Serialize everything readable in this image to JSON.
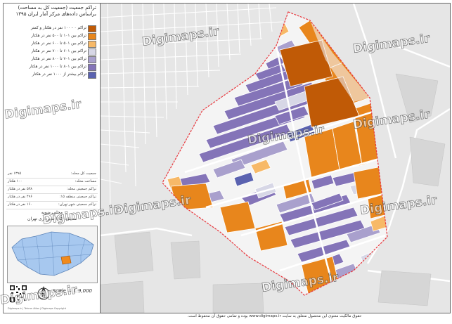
{
  "title": {
    "line1": "تراکم جمعیت (جمعیت کل به مساحت)",
    "line2": "براساس داده‌های مرکز آمار ایران ۱۳۹۵"
  },
  "legend": [
    {
      "label": "تراکم ۰ - ۱۰۰ نفر در هکتار و کمتر",
      "color": "#c05a06"
    },
    {
      "label": "تراکم بین ۱۰۱ تا ۵۰۰ نفر در هکتار",
      "color": "#e8861c"
    },
    {
      "label": "تراکم بین ۵۰۱ تا ۶۰۰ نفر در هکتار",
      "color": "#f7b968"
    },
    {
      "label": "تراکم بین ۶۰۱ تا ۷۰۰ نفر در هکتار",
      "color": "#d7d7e6"
    },
    {
      "label": "تراکم بین ۷۰۱ تا ۸۰۰ نفر در هکتار",
      "color": "#a9a0cd"
    },
    {
      "label": "تراکم بین ۸۰۱ تا ۱۰۰۰ نفر در هکتار",
      "color": "#8474b8"
    },
    {
      "label": "تراکم بیشتر از ۱۰۰۰ نفر در هکتار",
      "color": "#5a62b0"
    }
  ],
  "stats": [
    {
      "label": "جمعیت کل محله:",
      "value": "۱۳۹۵ نفر"
    },
    {
      "label": "مساحت محله:",
      "value": "۱۰۰ هکتار"
    },
    {
      "label": "تراکم جمعیتی محله:",
      "value": "۵۳۸ نفر در هکتار"
    },
    {
      "label": "تراکم جمعیتی منطقه ۱۵:",
      "value": "۴۹۶ نفر در هکتار"
    },
    {
      "label": "تراکم جمعیتی شهر تهران:",
      "value": "۱۶۰ نفر در هکتار"
    }
  ],
  "region": {
    "line1": "محله رضویه",
    "line2": "منطقه (۱۵) شهرداری تهران"
  },
  "scale": "Scale = 1:9,000",
  "north": "N",
  "copyright": "Digimaps.ir | Tehran Atlas | Digimaps Copyright",
  "footer": "حقوق مالکیت معنوی این محصول متعلق به سایت www.digimaps.ir بوده و تمامی حقوق آن محفوظ است.",
  "watermark": "Digimaps.ir",
  "colors": {
    "c0": "#c05a06",
    "c1": "#e8861c",
    "c2": "#f7b968",
    "c3": "#d7d7e6",
    "c4": "#a9a0cd",
    "c5": "#8474b8",
    "c6": "#5a62b0",
    "boundary": "#e8343a",
    "base": "#e9e9e9",
    "road": "#ffffff"
  }
}
